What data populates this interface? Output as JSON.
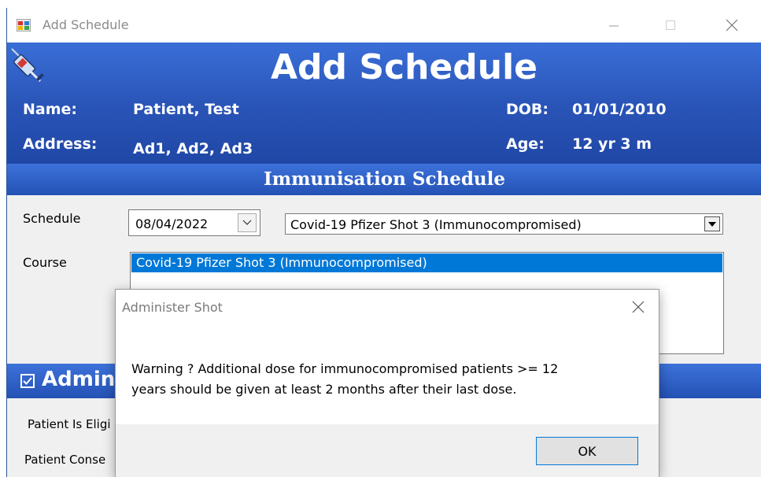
{
  "window": {
    "title": "Add Schedule"
  },
  "header": {
    "title": "Add Schedule",
    "name_label": "Name:",
    "name_value": "Patient, Test",
    "address_label": "Address:",
    "address_value": "Ad1, Ad2, Ad3",
    "dob_label": "DOB:",
    "dob_value": "01/01/2010",
    "age_label": "Age:",
    "age_value": "12 yr 3 m"
  },
  "schedule_section": {
    "title": "Immunisation Schedule",
    "schedule_label": "Schedule",
    "date_value": "08/04/2022",
    "schedule_value": "Covid-19 Pfizer Shot 3 (Immunocompromised)",
    "course_label": "Course",
    "course_items": [
      "Covid-19 Pfizer Shot 3 (Immunocompromised)"
    ]
  },
  "admin_section": {
    "title": "Admin",
    "checked": true,
    "eligible_label": "Patient Is Eligi",
    "consent_label": "Patient Conse"
  },
  "dialog": {
    "title": "Administer Shot",
    "message_line1": "Warning ? Additional dose for immunocompromised patients >= 12",
    "message_line2": "years should be given at least 2 months after their last dose.",
    "ok_label": "OK"
  },
  "colors": {
    "header_blue": "#2a55b8",
    "selection_blue": "#0078d7"
  }
}
